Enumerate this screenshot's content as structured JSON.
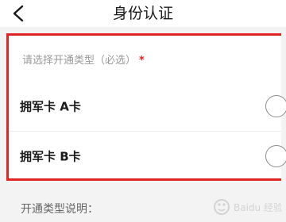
{
  "header": {
    "title": "身份认证",
    "back_icon": "chevron-left-icon"
  },
  "form": {
    "prompt": "请选择开通类型（必选）",
    "required_mark": "*",
    "options": [
      {
        "label": "拥军卡 A卡",
        "selected": false
      },
      {
        "label": "拥军卡 B卡",
        "selected": false
      }
    ],
    "description_label": "开通类型说明："
  },
  "watermark": {
    "text": "Baidu 经验"
  },
  "colors": {
    "highlight": "#e02424",
    "background": "#f3f3f3"
  }
}
